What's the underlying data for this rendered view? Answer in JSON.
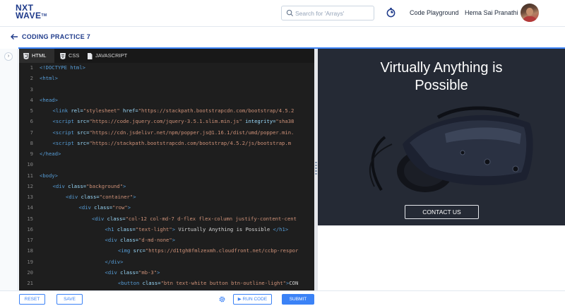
{
  "brand": {
    "line1": "NXT",
    "line2": "WAVE",
    "mark": "TM"
  },
  "header": {
    "search_placeholder": "Search for 'Arrays'",
    "timer_icon": "stopwatch-icon",
    "code_playground_label": "Code Playground",
    "user_name": "Hema Sai Pranathi"
  },
  "breadcrumb": {
    "title": "CODING PRACTICE 7"
  },
  "editor": {
    "tabs": [
      {
        "label": "HTML",
        "icon": "html5-icon",
        "active": true
      },
      {
        "label": "CSS",
        "icon": "css3-icon",
        "active": false
      },
      {
        "label": "JAVASCRIPT",
        "icon": "js-icon",
        "active": false
      }
    ],
    "lines": [
      {
        "n": "1",
        "indent": 0,
        "parts": [
          [
            "tag",
            "<!DOCTYPE html>"
          ]
        ]
      },
      {
        "n": "2",
        "indent": 0,
        "parts": [
          [
            "tag",
            "<html>"
          ]
        ]
      },
      {
        "n": "3",
        "indent": 0,
        "parts": []
      },
      {
        "n": "4",
        "indent": 0,
        "parts": [
          [
            "tag",
            "<head>"
          ]
        ]
      },
      {
        "n": "5",
        "indent": 1,
        "parts": [
          [
            "tag",
            "<link "
          ],
          [
            "attr",
            "rel="
          ],
          [
            "str",
            "\"stylesheet\" "
          ],
          [
            "attr",
            "href="
          ],
          [
            "str",
            "\"https://stackpath.bootstrapcdn.com/bootstrap/4.5.2"
          ]
        ]
      },
      {
        "n": "6",
        "indent": 1,
        "parts": [
          [
            "tag",
            "<script "
          ],
          [
            "attr",
            "src="
          ],
          [
            "str",
            "\"https://code.jquery.com/jquery-3.5.1.slim.min.js\" "
          ],
          [
            "attr",
            "integrity="
          ],
          [
            "str",
            "\"sha38"
          ]
        ]
      },
      {
        "n": "7",
        "indent": 1,
        "parts": [
          [
            "tag",
            "<script "
          ],
          [
            "attr",
            "src="
          ],
          [
            "str",
            "\"https://cdn.jsdelivr.net/npm/popper.js@1.16.1/dist/umd/popper.min."
          ]
        ]
      },
      {
        "n": "8",
        "indent": 1,
        "parts": [
          [
            "tag",
            "<script "
          ],
          [
            "attr",
            "src="
          ],
          [
            "str",
            "\"https://stackpath.bootstrapcdn.com/bootstrap/4.5.2/js/bootstrap.m"
          ]
        ]
      },
      {
        "n": "9",
        "indent": 0,
        "parts": [
          [
            "tag",
            "</head>"
          ]
        ]
      },
      {
        "n": "10",
        "indent": 0,
        "parts": []
      },
      {
        "n": "11",
        "indent": 0,
        "parts": [
          [
            "tag",
            "<body>"
          ]
        ]
      },
      {
        "n": "12",
        "indent": 1,
        "parts": [
          [
            "tag",
            "<div "
          ],
          [
            "attr",
            "class="
          ],
          [
            "str",
            "\"background\""
          ],
          [
            "tag",
            ">"
          ]
        ]
      },
      {
        "n": "13",
        "indent": 2,
        "parts": [
          [
            "tag",
            "<div "
          ],
          [
            "attr",
            "class="
          ],
          [
            "str",
            "\"container\""
          ],
          [
            "tag",
            ">"
          ]
        ]
      },
      {
        "n": "14",
        "indent": 3,
        "parts": [
          [
            "tag",
            "<div "
          ],
          [
            "attr",
            "class="
          ],
          [
            "str",
            "\"row\""
          ],
          [
            "tag",
            ">"
          ]
        ]
      },
      {
        "n": "15",
        "indent": 4,
        "parts": [
          [
            "tag",
            "<div "
          ],
          [
            "attr",
            "class="
          ],
          [
            "str",
            "\"col-12 col-md-7 d-flex flex-column justify-content-cent"
          ]
        ]
      },
      {
        "n": "16",
        "indent": 5,
        "parts": [
          [
            "tag",
            "<h1 "
          ],
          [
            "attr",
            "class="
          ],
          [
            "str",
            "\"text-light\""
          ],
          [
            "tag",
            ">"
          ],
          [
            "plain",
            " Virtually Anything is Possible "
          ],
          [
            "tag",
            "</h1>"
          ]
        ]
      },
      {
        "n": "17",
        "indent": 5,
        "parts": [
          [
            "tag",
            "<div "
          ],
          [
            "attr",
            "class="
          ],
          [
            "str",
            "\"d-md-none\""
          ],
          [
            "tag",
            ">"
          ]
        ]
      },
      {
        "n": "18",
        "indent": 6,
        "parts": [
          [
            "tag",
            "<img "
          ],
          [
            "attr",
            "src="
          ],
          [
            "str",
            "\"https://d1tgh8fmlzexmh.cloudfront.net/ccbp-respor"
          ]
        ]
      },
      {
        "n": "19",
        "indent": 5,
        "parts": [
          [
            "tag",
            "</div>"
          ]
        ]
      },
      {
        "n": "20",
        "indent": 5,
        "parts": [
          [
            "tag",
            "<div "
          ],
          [
            "attr",
            "class="
          ],
          [
            "str",
            "\"mb-3\""
          ],
          [
            "tag",
            ">"
          ]
        ]
      },
      {
        "n": "21",
        "indent": 6,
        "parts": [
          [
            "tag",
            "<button "
          ],
          [
            "attr",
            "class="
          ],
          [
            "str",
            "\"btn text-white button btn-outline-light\""
          ],
          [
            "tag",
            ">"
          ],
          [
            "plain",
            "CON"
          ]
        ]
      }
    ]
  },
  "preview": {
    "heading": "Virtually Anything is Possible",
    "button_label": "CONTACT US",
    "background_color": "#252a35"
  },
  "footer": {
    "reset_label": "RESET",
    "save_label": "SAVE",
    "run_label": "▶ RUN CODE",
    "submit_label": "SUBMIT"
  },
  "colors": {
    "accent": "#3b82f6",
    "brand": "#1e3a8a",
    "editor_bg": "#1e1e1e"
  }
}
